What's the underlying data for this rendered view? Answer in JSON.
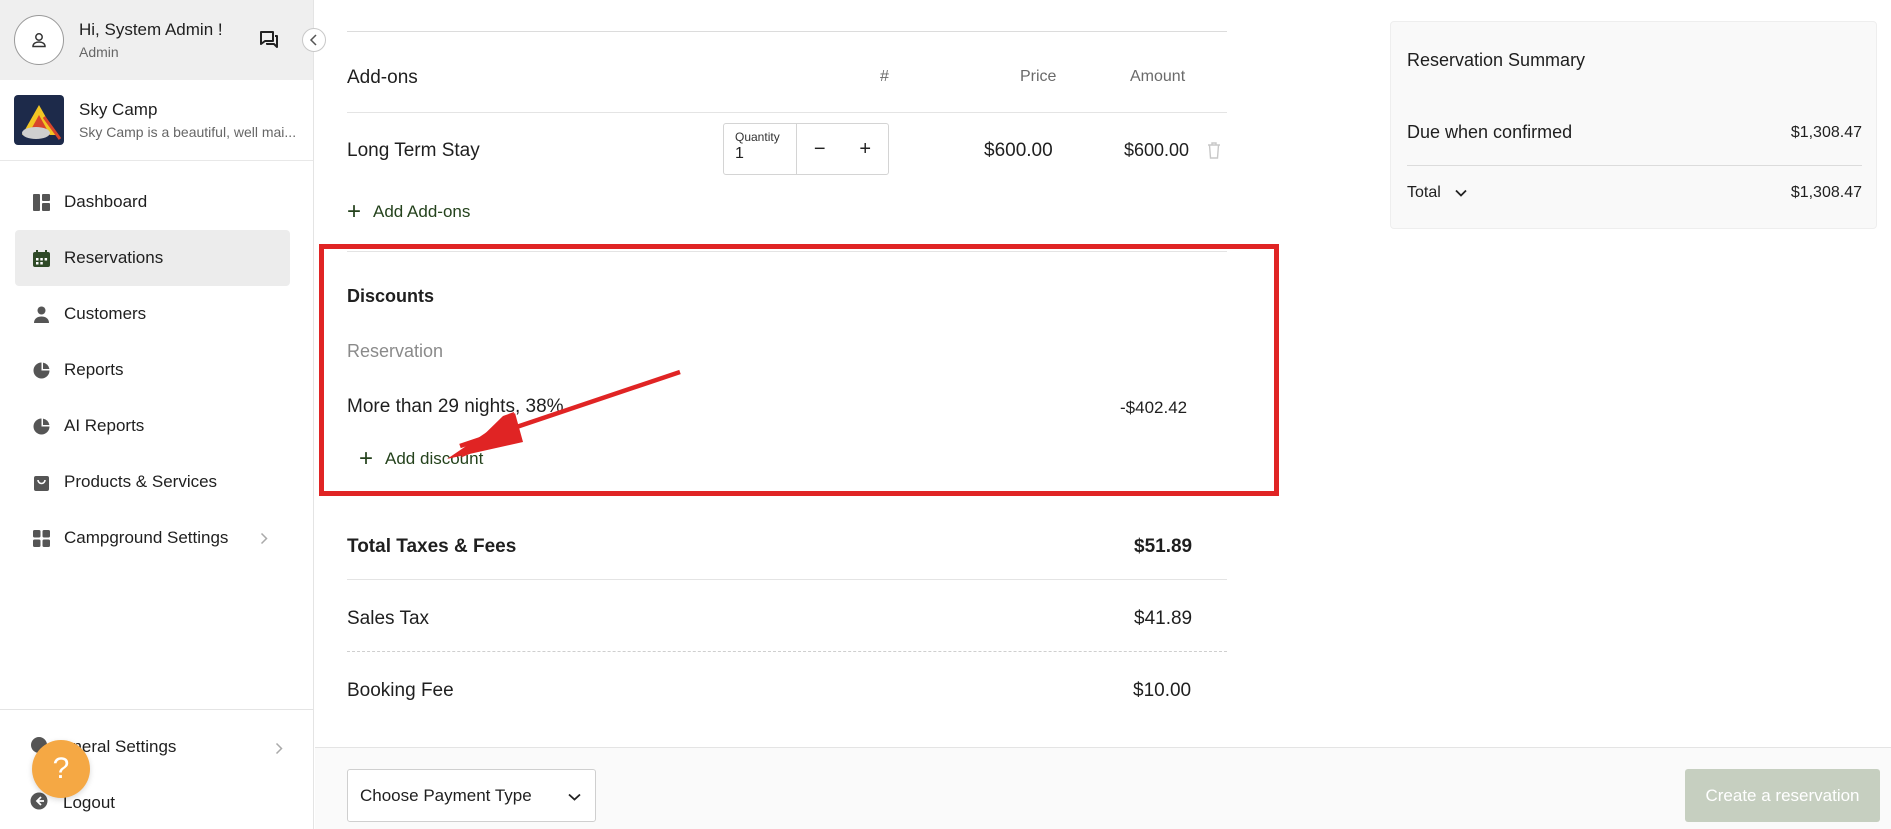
{
  "user": {
    "greeting": "Hi, System Admin !",
    "role": "Admin"
  },
  "campground": {
    "name": "Sky Camp",
    "description": "Sky Camp is a beautiful, well mai..."
  },
  "nav": {
    "items": [
      {
        "label": "Dashboard",
        "icon": "dashboard-icon"
      },
      {
        "label": "Reservations",
        "icon": "calendar-icon"
      },
      {
        "label": "Customers",
        "icon": "person-icon"
      },
      {
        "label": "Reports",
        "icon": "pie-chart-icon"
      },
      {
        "label": "AI Reports",
        "icon": "pie-chart-icon"
      },
      {
        "label": "Products & Services",
        "icon": "shopping-bag-icon"
      },
      {
        "label": "Campground Settings",
        "icon": "grid-icon"
      }
    ],
    "active": "Reservations",
    "bottom": {
      "general_settings": "eneral Settings",
      "logout": "Logout"
    }
  },
  "addons": {
    "title": "Add-ons",
    "col_num": "#",
    "col_price": "Price",
    "col_amount": "Amount",
    "item": {
      "name": "Long Term Stay",
      "quantity_label": "Quantity",
      "quantity": "1",
      "minus": "−",
      "plus": "+",
      "price": "$600.00",
      "amount": "$600.00"
    },
    "add_label": "Add Add-ons"
  },
  "discounts": {
    "title": "Discounts",
    "subheading": "Reservation",
    "item": {
      "name": "More than 29 nights, 38%",
      "amount": "-$402.42"
    },
    "add_label": "Add discount"
  },
  "taxes": {
    "total_label": "Total Taxes & Fees",
    "total_value": "$51.89",
    "sales_tax_label": "Sales Tax",
    "sales_tax_value": "$41.89",
    "booking_fee_label": "Booking Fee",
    "booking_fee_value": "$10.00"
  },
  "summary": {
    "title": "Reservation Summary",
    "due_label": "Due when confirmed",
    "due_value": "$1,308.47",
    "total_label": "Total",
    "total_value": "$1,308.47"
  },
  "footer": {
    "payment_placeholder": "Choose Payment Type",
    "create_label": "Create a reservation"
  },
  "colors": {
    "accent_green": "#24421c",
    "highlight_red": "#e02424",
    "help_orange": "#f5a844",
    "disabled_button": "#c6cfc0"
  }
}
